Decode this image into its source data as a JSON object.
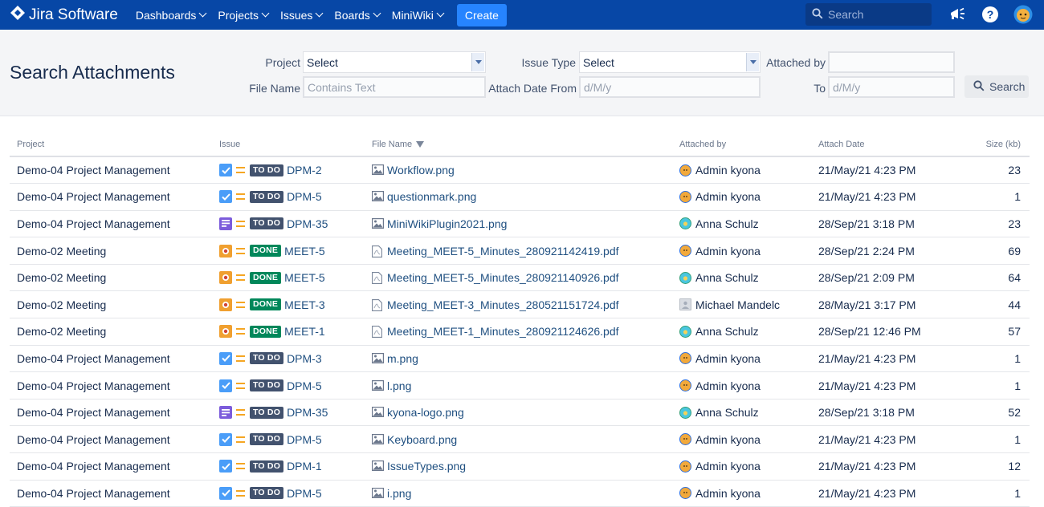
{
  "nav": {
    "logo_text": "Jira Software",
    "items": [
      "Dashboards",
      "Projects",
      "Issues",
      "Boards",
      "MiniWiki"
    ],
    "create_label": "Create",
    "search_placeholder": "Search"
  },
  "page": {
    "title": "Search Attachments"
  },
  "filters": {
    "project_label": "Project",
    "project_value": "Select",
    "issue_type_label": "Issue Type",
    "issue_type_value": "Select",
    "attached_by_label": "Attached by",
    "attached_by_value": "",
    "file_name_label": "File Name",
    "file_name_placeholder": "Contains Text",
    "attach_date_from_label": "Attach Date From",
    "attach_date_from_placeholder": "d/M/y",
    "to_label": "To",
    "to_placeholder": "d/M/y",
    "search_label": "Search"
  },
  "table": {
    "columns": {
      "project": "Project",
      "issue": "Issue",
      "file_name": "File Name",
      "attached_by": "Attached by",
      "attach_date": "Attach Date",
      "size": "Size (kb)"
    },
    "rows": [
      {
        "project": "Demo-04 Project Management",
        "type": "task",
        "status": "TO DO",
        "issue": "DPM-2",
        "file_type": "image",
        "file": "Workflow.png",
        "user_avatar": "admin",
        "user": "Admin kyona",
        "date": "21/May/21 4:23 PM",
        "size": "23"
      },
      {
        "project": "Demo-04 Project Management",
        "type": "task",
        "status": "TO DO",
        "issue": "DPM-5",
        "file_type": "image",
        "file": "questionmark.png",
        "user_avatar": "admin",
        "user": "Admin kyona",
        "date": "21/May/21 4:23 PM",
        "size": "1"
      },
      {
        "project": "Demo-04 Project Management",
        "type": "story",
        "status": "TO DO",
        "issue": "DPM-35",
        "file_type": "image",
        "file": "MiniWikiPlugin2021.png",
        "user_avatar": "anna",
        "user": "Anna Schulz",
        "date": "28/Sep/21 3:18 PM",
        "size": "23"
      },
      {
        "project": "Demo-02 Meeting",
        "type": "meeting",
        "status": "DONE",
        "issue": "MEET-5",
        "file_type": "pdf",
        "file": "Meeting_MEET-5_Minutes_280921142419.pdf",
        "user_avatar": "admin",
        "user": "Admin kyona",
        "date": "28/Sep/21 2:24 PM",
        "size": "69"
      },
      {
        "project": "Demo-02 Meeting",
        "type": "meeting",
        "status": "DONE",
        "issue": "MEET-5",
        "file_type": "pdf",
        "file": "Meeting_MEET-5_Minutes_280921140926.pdf",
        "user_avatar": "anna",
        "user": "Anna Schulz",
        "date": "28/Sep/21 2:09 PM",
        "size": "64"
      },
      {
        "project": "Demo-02 Meeting",
        "type": "meeting",
        "status": "DONE",
        "issue": "MEET-3",
        "file_type": "pdf",
        "file": "Meeting_MEET-3_Minutes_280521151724.pdf",
        "user_avatar": "michael",
        "user": "Michael Mandelc",
        "date": "28/May/21 3:17 PM",
        "size": "44"
      },
      {
        "project": "Demo-02 Meeting",
        "type": "meeting",
        "status": "DONE",
        "issue": "MEET-1",
        "file_type": "pdf",
        "file": "Meeting_MEET-1_Minutes_280921124626.pdf",
        "user_avatar": "anna",
        "user": "Anna Schulz",
        "date": "28/Sep/21 12:46 PM",
        "size": "57"
      },
      {
        "project": "Demo-04 Project Management",
        "type": "task",
        "status": "TO DO",
        "issue": "DPM-3",
        "file_type": "image",
        "file": "m.png",
        "user_avatar": "admin",
        "user": "Admin kyona",
        "date": "21/May/21 4:23 PM",
        "size": "1"
      },
      {
        "project": "Demo-04 Project Management",
        "type": "task",
        "status": "TO DO",
        "issue": "DPM-5",
        "file_type": "image",
        "file": "l.png",
        "user_avatar": "admin",
        "user": "Admin kyona",
        "date": "21/May/21 4:23 PM",
        "size": "1"
      },
      {
        "project": "Demo-04 Project Management",
        "type": "story",
        "status": "TO DO",
        "issue": "DPM-35",
        "file_type": "image",
        "file": "kyona-logo.png",
        "user_avatar": "anna",
        "user": "Anna Schulz",
        "date": "28/Sep/21 3:18 PM",
        "size": "52"
      },
      {
        "project": "Demo-04 Project Management",
        "type": "task",
        "status": "TO DO",
        "issue": "DPM-5",
        "file_type": "image",
        "file": "Keyboard.png",
        "user_avatar": "admin",
        "user": "Admin kyona",
        "date": "21/May/21 4:23 PM",
        "size": "1"
      },
      {
        "project": "Demo-04 Project Management",
        "type": "task",
        "status": "TO DO",
        "issue": "DPM-1",
        "file_type": "image",
        "file": "IssueTypes.png",
        "user_avatar": "admin",
        "user": "Admin kyona",
        "date": "21/May/21 4:23 PM",
        "size": "12"
      },
      {
        "project": "Demo-04 Project Management",
        "type": "task",
        "status": "TO DO",
        "issue": "DPM-5",
        "file_type": "image",
        "file": "i.png",
        "user_avatar": "admin",
        "user": "Admin kyona",
        "date": "21/May/21 4:23 PM",
        "size": "1"
      }
    ]
  },
  "icons": {
    "logo": "jira-diamond-icon",
    "search": "search-icon",
    "notifications": "megaphone-icon",
    "help": "help-icon",
    "profile": "avatar"
  },
  "colors": {
    "nav_bg": "#0747a6",
    "create": "#2684ff",
    "todo": "#42526e",
    "done": "#00875a",
    "link": "#205081"
  }
}
